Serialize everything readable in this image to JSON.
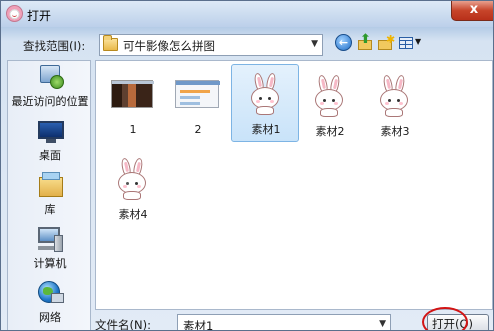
{
  "window": {
    "title": "打开",
    "close_glyph": "x"
  },
  "toolbar": {
    "look_in_label": "查找范围(I):",
    "look_in_value": "可牛影像怎么拼图",
    "combo_arrow": "▼",
    "back_glyph": "←",
    "up_arrow_glyph": "⬆",
    "new_folder_glyph": "✱",
    "views_arrow": "▼"
  },
  "places": [
    {
      "label": "最近访问的位置",
      "icon": "recent-places-icon"
    },
    {
      "label": "桌面",
      "icon": "desktop-icon"
    },
    {
      "label": "库",
      "icon": "library-icon"
    },
    {
      "label": "计算机",
      "icon": "computer-icon"
    },
    {
      "label": "网络",
      "icon": "network-icon"
    }
  ],
  "files": [
    {
      "name": "1",
      "thumb": "screenshot-thumb",
      "selected": false
    },
    {
      "name": "2",
      "thumb": "screenshot-thumb",
      "selected": false
    },
    {
      "name": "素材1",
      "thumb": "bunny-thumb",
      "selected": true
    },
    {
      "name": "素材2",
      "thumb": "bunny-thumb",
      "selected": false
    },
    {
      "name": "素材3",
      "thumb": "bunny-thumb",
      "selected": false
    },
    {
      "name": "素材4",
      "thumb": "bunny-thumb",
      "selected": false
    }
  ],
  "footer": {
    "filename_label": "文件名(N):",
    "filename_value": "素材1",
    "filename_arrow": "▼",
    "open_button_label": "打开(O)"
  },
  "colors": {
    "selection": "#c9e3f9",
    "highlight_ring": "#d21414",
    "close_button": "#c7442a"
  }
}
